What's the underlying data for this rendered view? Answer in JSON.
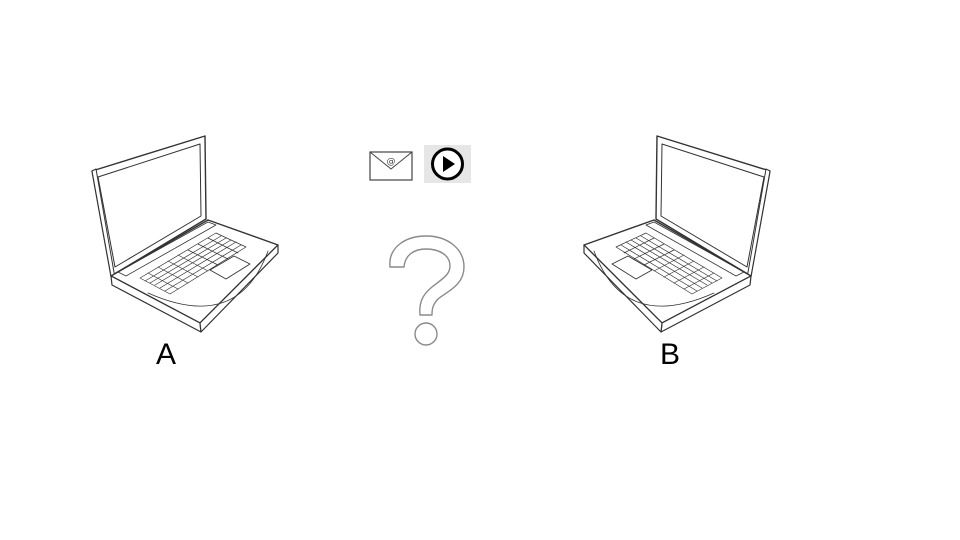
{
  "nodes": [
    {
      "id": "A",
      "label": "A",
      "icon": "laptop-icon"
    },
    {
      "id": "B",
      "label": "B",
      "icon": "laptop-icon"
    }
  ],
  "transfer": {
    "items": [
      {
        "icon": "email-icon",
        "glyph": "@"
      },
      {
        "icon": "play-icon"
      }
    ],
    "unknown_icon": "question-mark-icon"
  },
  "colors": {
    "stroke": "#333333",
    "play_badge": "#e6e6e6",
    "question_stroke": "#8a8a8a"
  }
}
